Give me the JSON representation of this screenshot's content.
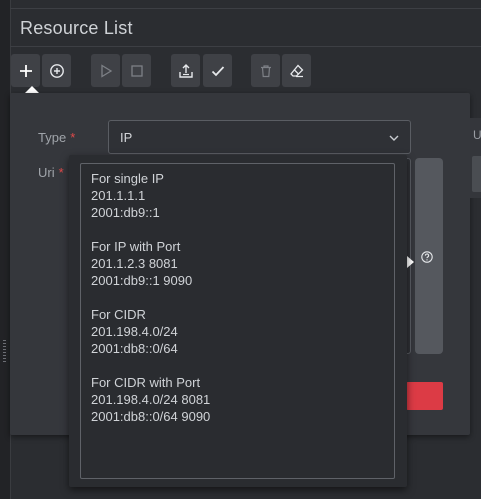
{
  "header": {
    "title": "Resource List"
  },
  "toolbar": {
    "buttons": [
      {
        "name": "add",
        "icon": "plus-icon"
      },
      {
        "name": "add-circle",
        "icon": "plus-circle-icon"
      },
      {
        "name": "start",
        "icon": "play-icon"
      },
      {
        "name": "stop",
        "icon": "stop-icon"
      },
      {
        "name": "import",
        "icon": "import-tray-icon"
      },
      {
        "name": "confirm",
        "icon": "check-icon"
      },
      {
        "name": "delete",
        "icon": "trash-icon"
      },
      {
        "name": "erase",
        "icon": "eraser-icon"
      }
    ]
  },
  "form": {
    "type_label": "Type",
    "type_value": "IP",
    "uri_label": "Uri",
    "required_mark": "*",
    "right_label": "U"
  },
  "tooltip": {
    "text": "For single IP\n201.1.1.1\n2001:db9::1\n\nFor IP with Port\n201.1.2.3 8081\n2001:db9::1 9090\n\nFor CIDR\n201.198.4.0/24\n2001:db8::0/64\n\nFor CIDR with Port\n201.198.4.0/24 8081\n2001:db8::0/64 9090"
  },
  "colors": {
    "background": "#2b2d31",
    "panel": "#35373c",
    "danger": "#dc3b45",
    "required": "#e04a4a"
  }
}
